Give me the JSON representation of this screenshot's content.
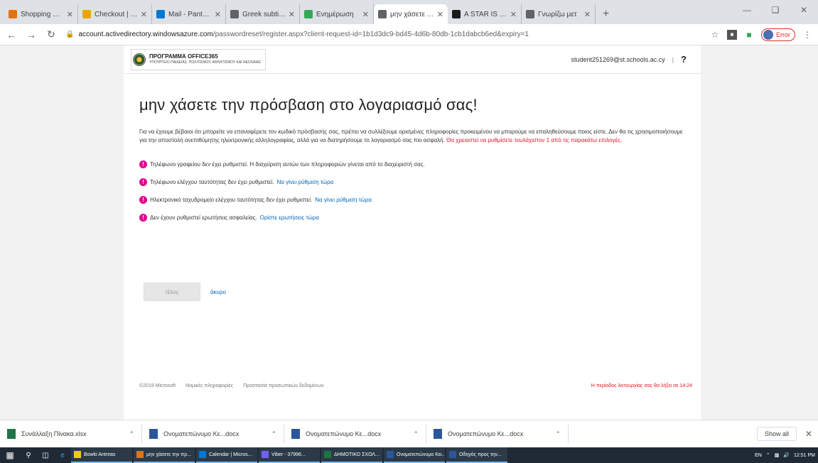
{
  "browser": {
    "tabs": [
      {
        "title": "Shopping Cart",
        "color": "#e8710a"
      },
      {
        "title": "Checkout | eBay",
        "color": "#e6a800"
      },
      {
        "title": "Mail - Pantelis",
        "color": "#0078d4"
      },
      {
        "title": "Greek subtitles",
        "color": "#5f6368"
      },
      {
        "title": "Ενημέρωση",
        "color": "#34a853"
      },
      {
        "title": "μην χάσετε την",
        "color": "#5f6368",
        "active": true
      },
      {
        "title": "A STAR IS BORN",
        "color": "#1a1a1a"
      },
      {
        "title": "Γνωρίζω μετ",
        "color": "#5f6368"
      }
    ],
    "url_host": "account.activedirectory.windowsazure.com",
    "url_path": "/passwordreset/register.aspx?client-request-id=1b1d3dc9-bd45-4d6b-80db-1cb1dabcb6ed&expiry=1",
    "profile_label": "Error"
  },
  "page": {
    "logo_line1": "ΠΡΟΓΡΑΜΜΑ OFFICE365",
    "logo_line2": "ΥΠΟΥΡΓΕΙΟ ΠΑΙΔΕΙΑΣ, ΠΟΛΙΤΙΣΜΟΥ, ΑΘΛΗΤΙΣΜΟΥ ΚΑΙ ΝΕΟΛΑΙΑΣ",
    "account": "student251269@st.schools.ac.cy",
    "help": "?",
    "title": "μην χάσετε την πρόσβαση στο λογαριασμό σας!",
    "intro": "Για να έχουμε βέβαιοι ότι μπορείτε να επαναφέρετε τον κωδικό πρόσβασής σας, πρέπει να συλλέξουμε ορισμένες πληροφορίες προκειμένου να μπορούμε να επαληθεύσουμε ποιος είστε. Δεν θα τις χρησιμοποιήσουμε για την αποστολή ανεπιθύμητης ηλεκτρονικής αλληλογραφίας, αλλά για να διατηρήσουμε το λογαριασμό σας πιο ασφαλή.",
    "intro_required": "Θα χρειαστεί να ρυθμίσετε τουλάχιστον 1 από τις παρακάτω επιλογές.",
    "items": [
      {
        "text": "Τηλέφωνο γραφείου δεν έχει ρυθμιστεί. Η διαχείριση αυτών των πληροφοριών γίνεται από το διαχειριστή σας.",
        "link": ""
      },
      {
        "text": "Τηλέφωνο ελέγχου ταυτότητας δεν έχει ρυθμιστεί.",
        "link": "Να γίνει ρύθμιση τώρα"
      },
      {
        "text": "Ηλεκτρονικό ταχυδρομείο ελέγχου ταυτότητας δεν έχει ρυθμιστεί.",
        "link": "Να γίνει ρύθμιση τώρα"
      },
      {
        "text": "Δεν έχουν ρυθμιστεί ερωτήσεις ασφαλείας.",
        "link": "Ορίστε ερωτήσεις τώρα"
      }
    ],
    "done_label": "τέλος",
    "cancel_label": "άκυρο",
    "footer": [
      "©2019 Microsoft",
      "Νομικές πληροφορίες",
      "Προστασία προσωπικών δεδομένων"
    ],
    "footer_warning": "Η περίοδος λειτουργίας σας θα λήξει σε 14:24"
  },
  "downloads": {
    "items": [
      "Συνάλλαξη Πίνακα.xlsx",
      "Ονοματεπώνυμο Κε...docx",
      "Ονοματεπώνυμο Κε...docx",
      "Ονοματεπώνυμο Κε...docx"
    ],
    "show_all": "Show all"
  },
  "taskbar": {
    "apps": [
      {
        "label": "Bowki Antreas",
        "color": "#f2c811"
      },
      {
        "label": "μην χάσετε την πρ...",
        "color": "#e8710a"
      },
      {
        "label": "Calendar | Micros...",
        "color": "#0078d4"
      },
      {
        "label": "Viber - 37996...",
        "color": "#7360f2"
      },
      {
        "label": "ΔΗΜΟΤΙΚΟ ΣΧΟΛ...",
        "color": "#217346"
      },
      {
        "label": "Ονοματεπώνυμο Κει...",
        "color": "#2b579a"
      },
      {
        "label": "Οδηγός προς την...",
        "color": "#2b579a"
      }
    ],
    "lang": "EN",
    "time": "12:51 PM"
  }
}
